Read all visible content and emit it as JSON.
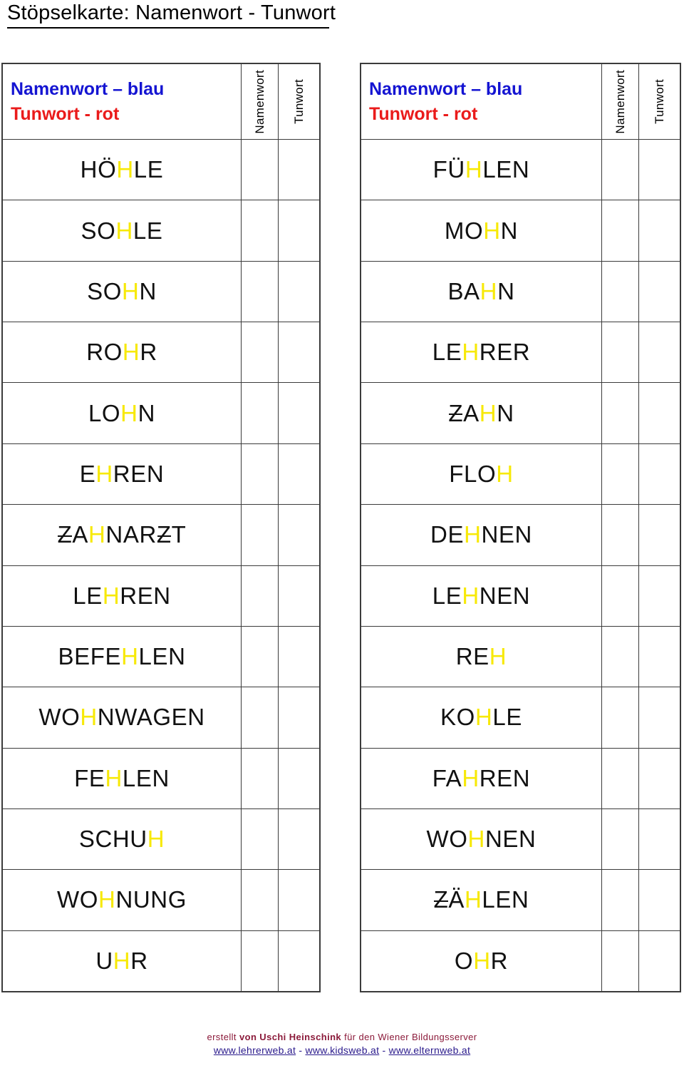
{
  "title": "Stöpselkarte: Namenwort - Tunwort",
  "legend": {
    "noun_line": "Namenwort – blau",
    "verb_line": "Tunwort - rot",
    "col_noun": "Namenwort",
    "col_verb": "Tunwort"
  },
  "colors": {
    "noun": "#1414d2",
    "verb": "#ea1b1b",
    "highlight": "#f7e908",
    "border": "#3b3b3b",
    "credit": "#8b1a3a",
    "link": "#2a1a8c"
  },
  "cards": [
    {
      "id": "left",
      "words": [
        {
          "text": "HÖHLE",
          "pre": "HÖ",
          "hl": "H",
          "post": "LE",
          "zstroke": []
        },
        {
          "text": "SOHLE",
          "pre": "SO",
          "hl": "H",
          "post": "LE",
          "zstroke": []
        },
        {
          "text": "SOHN",
          "pre": "SO",
          "hl": "H",
          "post": "N",
          "zstroke": []
        },
        {
          "text": "ROHR",
          "pre": "RO",
          "hl": "H",
          "post": "R",
          "zstroke": []
        },
        {
          "text": "LOHN",
          "pre": "LO",
          "hl": "H",
          "post": "N",
          "zstroke": []
        },
        {
          "text": "EHREN",
          "pre": "E",
          "hl": "H",
          "post": "REN",
          "zstroke": []
        },
        {
          "text": "ZAHNARZT",
          "pre": "ZA",
          "hl": "H",
          "post": "NARZT",
          "zstroke": [
            "pre0",
            "post3"
          ]
        },
        {
          "text": "LEHREN",
          "pre": "LE",
          "hl": "H",
          "post": "REN",
          "zstroke": []
        },
        {
          "text": "BEFEHLEN",
          "pre": "BEFE",
          "hl": "H",
          "post": "LEN",
          "zstroke": []
        },
        {
          "text": "WOHNWAGEN",
          "pre": "WO",
          "hl": "H",
          "post": "NWAGEN",
          "zstroke": []
        },
        {
          "text": "FEHLEN",
          "pre": "FE",
          "hl": "H",
          "post": "LEN",
          "zstroke": []
        },
        {
          "text": "SCHUH",
          "pre": "SCHU",
          "hl": "H",
          "post": "",
          "zstroke": []
        },
        {
          "text": "WOHNUNG",
          "pre": "WO",
          "hl": "H",
          "post": "NUNG",
          "zstroke": []
        },
        {
          "text": "UHR",
          "pre": "U",
          "hl": "H",
          "post": "R",
          "zstroke": []
        }
      ]
    },
    {
      "id": "right",
      "words": [
        {
          "text": "FÜHLEN",
          "pre": "FÜ",
          "hl": "H",
          "post": "LEN",
          "zstroke": []
        },
        {
          "text": "MOHN",
          "pre": "MO",
          "hl": "H",
          "post": "N",
          "zstroke": []
        },
        {
          "text": "BAHN",
          "pre": "BA",
          "hl": "H",
          "post": "N",
          "zstroke": []
        },
        {
          "text": "LEHRER",
          "pre": "LE",
          "hl": "H",
          "post": "RER",
          "zstroke": []
        },
        {
          "text": "ZAHN",
          "pre": "ZA",
          "hl": "H",
          "post": "N",
          "zstroke": [
            "pre0"
          ]
        },
        {
          "text": "FLOH",
          "pre": "FLO",
          "hl": "H",
          "post": "",
          "zstroke": []
        },
        {
          "text": "DEHNEN",
          "pre": "DE",
          "hl": "H",
          "post": "NEN",
          "zstroke": []
        },
        {
          "text": "LEHNEN",
          "pre": "LE",
          "hl": "H",
          "post": "NEN",
          "zstroke": []
        },
        {
          "text": "REH",
          "pre": "RE",
          "hl": "H",
          "post": "",
          "zstroke": []
        },
        {
          "text": "KOHLE",
          "pre": "KO",
          "hl": "H",
          "post": "LE",
          "zstroke": []
        },
        {
          "text": "FAHREN",
          "pre": "FA",
          "hl": "H",
          "post": "REN",
          "zstroke": []
        },
        {
          "text": "WOHNEN",
          "pre": "WO",
          "hl": "H",
          "post": "NEN",
          "zstroke": []
        },
        {
          "text": "ZÄHLEN",
          "pre": "ZÄ",
          "hl": "H",
          "post": "LEN",
          "zstroke": [
            "pre0"
          ]
        },
        {
          "text": "OHR",
          "pre": "O",
          "hl": "H",
          "post": "R",
          "zstroke": []
        }
      ]
    }
  ],
  "footer": {
    "credit_before": "erstellt ",
    "credit_strong": "von Uschi Heinschink",
    "credit_after": " für den Wiener Bildungsserver",
    "link1": "www.lehrerweb.at",
    "sep1": " - ",
    "link2": "www.kidsweb.at",
    "sep2": " - ",
    "link3": "www.elternweb.at"
  }
}
